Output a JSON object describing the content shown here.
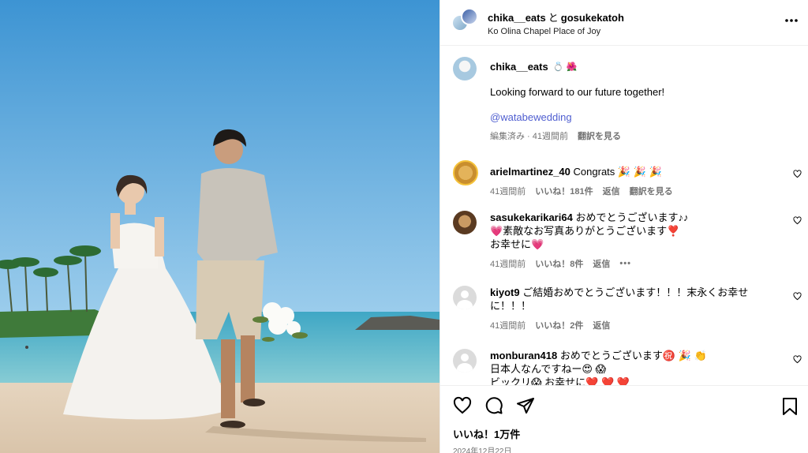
{
  "header": {
    "user1": "chika__eats",
    "connector": "と",
    "user2": "gosukekatoh",
    "location": "Ko Olina Chapel Place of Joy",
    "more_icon": "more-horizontal-icon"
  },
  "caption": {
    "username": "chika__eats",
    "emoji": "💍 🌺",
    "text": "Looking forward to our future together!",
    "mention": "@watabewedding",
    "meta_edited": "編集済み · 41週間前",
    "translate": "翻訳を見る"
  },
  "comments": [
    {
      "username": "arielmartinez_40",
      "text": "Congrats 🎉 🎉 🎉",
      "time": "41週間前",
      "likes": "いいね！181件",
      "reply": "返信",
      "translate": "翻訳を見る"
    },
    {
      "username": "sasukekarikari64",
      "line1": "おめでとうございます♪♪",
      "line2": "💗素敵なお写真ありがとうございます❣️",
      "line3": "お幸せに💗",
      "time": "41週間前",
      "likes": "いいね！8件",
      "reply": "返信",
      "more": "•••"
    },
    {
      "username": "kiyot9",
      "line1": "ご結婚おめでとうございます！！！末永くお幸せ",
      "line2": "に！！！",
      "time": "41週間前",
      "likes": "いいね！2件",
      "reply": "返信"
    },
    {
      "username": "monburan418",
      "line1": "おめでとうございます㊗️ 🎉 👏",
      "line2": "日本人なんですねー😍 😱",
      "line3": "ビックリ😱 お幸せに❤️ ❤️ ❤️"
    }
  ],
  "actions": {
    "likes": "いいね！1万件",
    "date": "2024年12月22日"
  },
  "colors": {
    "link": "#4f5ed0",
    "muted": "#737373",
    "border": "#efefef",
    "sky": "#5aa9dc"
  }
}
